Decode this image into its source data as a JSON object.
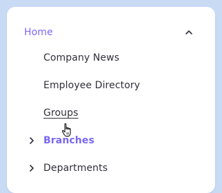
{
  "menu": {
    "home": {
      "label": "Home",
      "expanded": true
    },
    "items": [
      {
        "label": "Company News"
      },
      {
        "label": "Employee Directory"
      },
      {
        "label": "Groups"
      }
    ],
    "sections": [
      {
        "label": "Branches",
        "active": true
      },
      {
        "label": "Departments",
        "active": false
      }
    ]
  },
  "colors": {
    "accent": "#7b68f0",
    "text": "#2f2f3a",
    "background": "#c9daf5",
    "card": "#ffffff"
  },
  "icons": {
    "home_toggle": "chevron-up-icon",
    "section_toggle": "chevron-right-icon",
    "pointer": "hand-pointer-cursor-icon"
  }
}
